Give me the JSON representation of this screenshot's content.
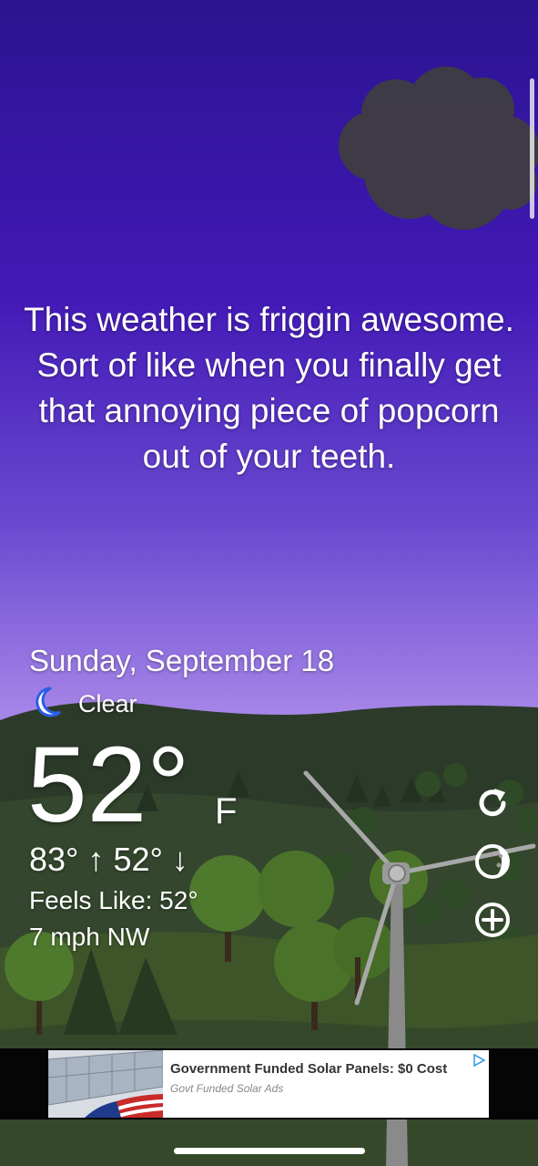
{
  "quote": "This weather is friggin awesome. Sort of like when you finally get that annoying piece of popcorn out of your teeth.",
  "weather": {
    "date": "Sunday, September 18",
    "condition": "Clear",
    "condition_icon": "moon-icon",
    "temperature": "52°",
    "unit": "F",
    "high_low": "83° ↑  52° ↓",
    "feels_like": "Feels Like: 52°",
    "wind": "7 mph NW"
  },
  "actions": [
    {
      "name": "refresh-icon"
    },
    {
      "name": "moon-phase-icon"
    },
    {
      "name": "add-icon"
    }
  ],
  "ad": {
    "title": "Government Funded Solar Panels: $0 Cost",
    "subtitle": "Govt Funded Solar Ads",
    "choice_icon": "ad-choices-icon"
  },
  "colors": {
    "sky_top": "#2a1490",
    "sky_bottom": "#b8a2ee",
    "hill_dark": "#2b3a26",
    "grass": "#3f5a2c"
  }
}
